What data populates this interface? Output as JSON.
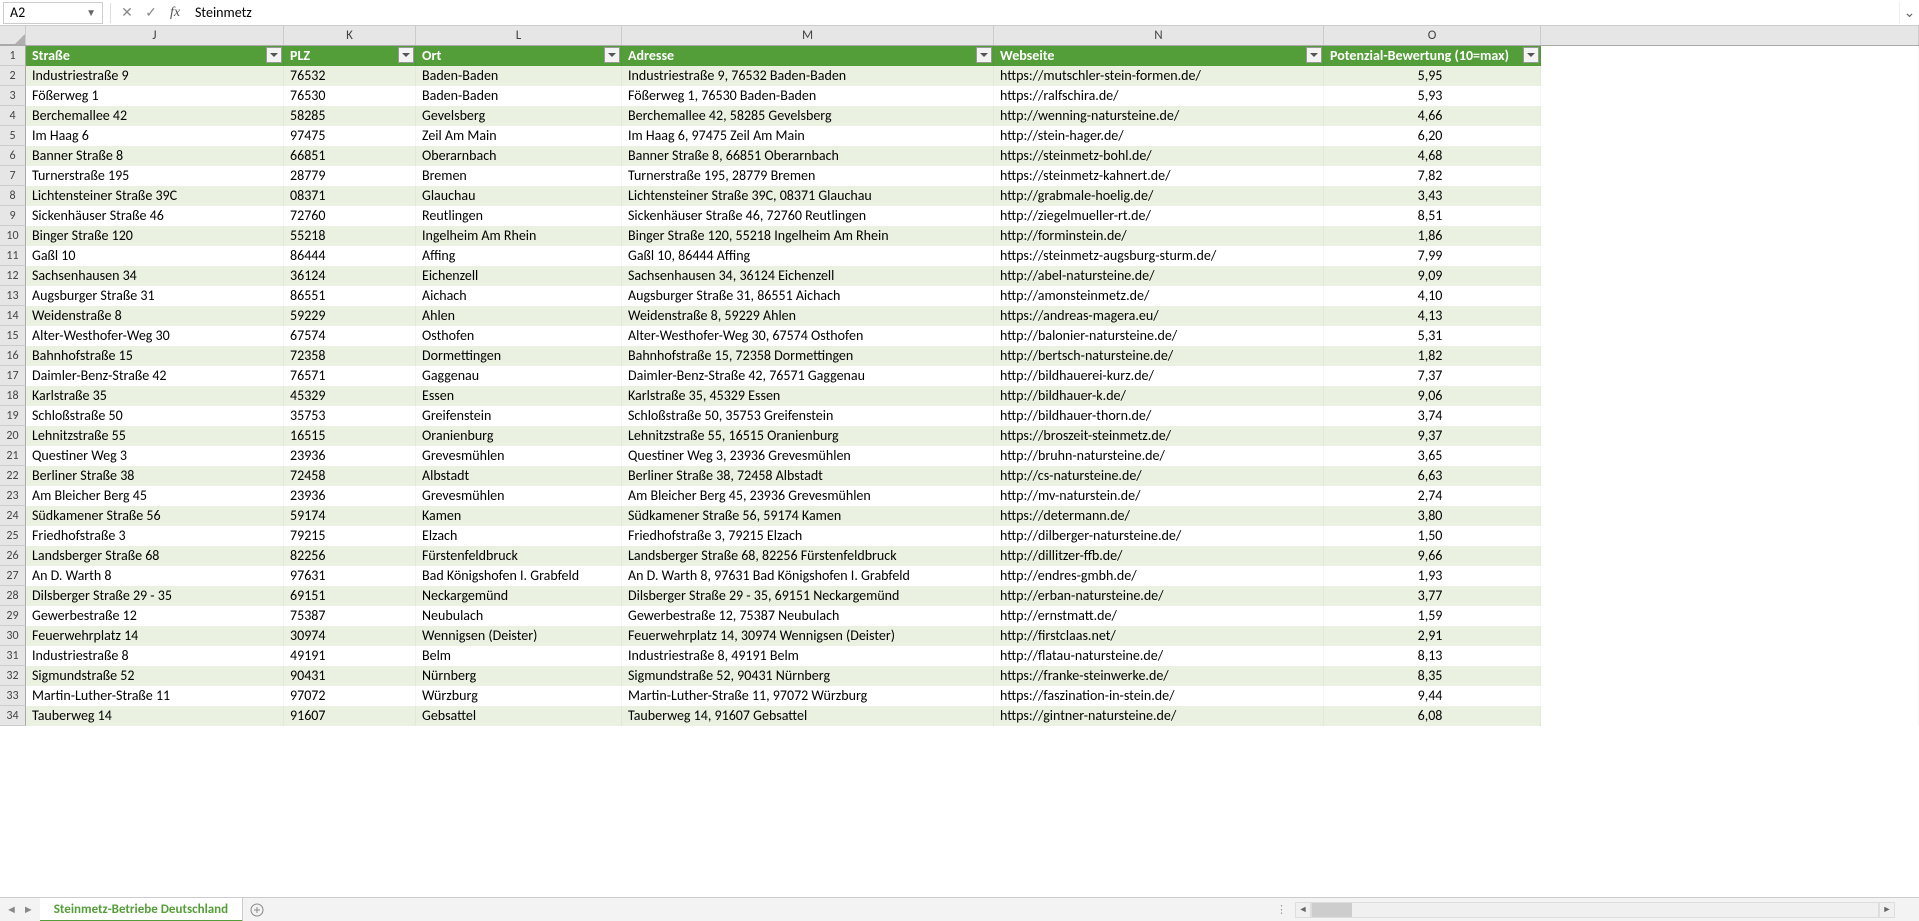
{
  "formula_bar": {
    "name_box": "A2",
    "formula": "Steinmetz"
  },
  "columns": [
    {
      "letter": "J",
      "label": "Straße",
      "cls": "col-J"
    },
    {
      "letter": "K",
      "label": "PLZ",
      "cls": "col-K"
    },
    {
      "letter": "L",
      "label": "Ort",
      "cls": "col-L"
    },
    {
      "letter": "M",
      "label": "Adresse",
      "cls": "col-M"
    },
    {
      "letter": "N",
      "label": "Webseite",
      "cls": "col-N"
    },
    {
      "letter": "O",
      "label": "Potenzial-Bewertung (10=max)",
      "cls": "col-O",
      "numeric": true
    }
  ],
  "rows": [
    {
      "n": 2,
      "d": [
        "Industriestraße 9",
        "76532",
        "Baden-Baden",
        "Industriestraße 9, 76532 Baden-Baden",
        "https://mutschler-stein-formen.de/",
        "5,95"
      ]
    },
    {
      "n": 3,
      "d": [
        "Fößerweg 1",
        "76530",
        "Baden-Baden",
        "Fößerweg 1, 76530 Baden-Baden",
        "https://ralfschira.de/",
        "5,93"
      ]
    },
    {
      "n": 4,
      "d": [
        "Berchemallee 42",
        "58285",
        "Gevelsberg",
        "Berchemallee 42, 58285 Gevelsberg",
        "http://wenning-natursteine.de/",
        "4,66"
      ]
    },
    {
      "n": 5,
      "d": [
        "Im Haag 6",
        "97475",
        "Zeil Am Main",
        "Im Haag 6, 97475 Zeil Am Main",
        "http://stein-hager.de/",
        "6,20"
      ]
    },
    {
      "n": 6,
      "d": [
        "Banner Straße 8",
        "66851",
        "Oberarnbach",
        "Banner Straße 8, 66851 Oberarnbach",
        "https://steinmetz-bohl.de/",
        "4,68"
      ]
    },
    {
      "n": 7,
      "d": [
        "Turnerstraße 195",
        "28779",
        "Bremen",
        "Turnerstraße 195, 28779 Bremen",
        "https://steinmetz-kahnert.de/",
        "7,82"
      ]
    },
    {
      "n": 8,
      "d": [
        "Lichtensteiner Straße 39C",
        "08371",
        "Glauchau",
        "Lichtensteiner Straße 39C, 08371 Glauchau",
        "http://grabmale-hoelig.de/",
        "3,43"
      ]
    },
    {
      "n": 9,
      "d": [
        "Sickenhäuser Straße 46",
        "72760",
        "Reutlingen",
        "Sickenhäuser Straße 46, 72760 Reutlingen",
        "http://ziegelmueller-rt.de/",
        "8,51"
      ]
    },
    {
      "n": 10,
      "d": [
        "Binger Straße 120",
        "55218",
        "Ingelheim Am Rhein",
        "Binger Straße 120, 55218 Ingelheim Am Rhein",
        "http://forminstein.de/",
        "1,86"
      ]
    },
    {
      "n": 11,
      "d": [
        "Gaßl 10",
        "86444",
        "Affing",
        "Gaßl 10, 86444 Affing",
        "https://steinmetz-augsburg-sturm.de/",
        "7,99"
      ]
    },
    {
      "n": 12,
      "d": [
        "Sachsenhausen 34",
        "36124",
        "Eichenzell",
        "Sachsenhausen 34, 36124 Eichenzell",
        "http://abel-natursteine.de/",
        "9,09"
      ]
    },
    {
      "n": 13,
      "d": [
        "Augsburger Straße 31",
        "86551",
        "Aichach",
        "Augsburger Straße 31, 86551 Aichach",
        "http://amonsteinmetz.de/",
        "4,10"
      ]
    },
    {
      "n": 14,
      "d": [
        "Weidenstraße 8",
        "59229",
        "Ahlen",
        "Weidenstraße 8, 59229 Ahlen",
        "https://andreas-magera.eu/",
        "4,13"
      ]
    },
    {
      "n": 15,
      "d": [
        "Alter-Westhofer-Weg 30",
        "67574",
        "Osthofen",
        "Alter-Westhofer-Weg 30, 67574 Osthofen",
        "http://balonier-natursteine.de/",
        "5,31"
      ]
    },
    {
      "n": 16,
      "d": [
        "Bahnhofstraße 15",
        "72358",
        "Dormettingen",
        "Bahnhofstraße 15, 72358 Dormettingen",
        "http://bertsch-natursteine.de/",
        "1,82"
      ]
    },
    {
      "n": 17,
      "d": [
        "Daimler-Benz-Straße 42",
        "76571",
        "Gaggenau",
        "Daimler-Benz-Straße 42, 76571 Gaggenau",
        "http://bildhauerei-kurz.de/",
        "7,37"
      ]
    },
    {
      "n": 18,
      "d": [
        "Karlstraße 35",
        "45329",
        "Essen",
        "Karlstraße 35, 45329 Essen",
        "http://bildhauer-k.de/",
        "9,06"
      ]
    },
    {
      "n": 19,
      "d": [
        "Schloßstraße 50",
        "35753",
        "Greifenstein",
        "Schloßstraße 50, 35753 Greifenstein",
        "http://bildhauer-thorn.de/",
        "3,74"
      ]
    },
    {
      "n": 20,
      "d": [
        "Lehnitzstraße 55",
        "16515",
        "Oranienburg",
        "Lehnitzstraße 55, 16515 Oranienburg",
        "https://broszeit-steinmetz.de/",
        "9,37"
      ]
    },
    {
      "n": 21,
      "d": [
        "Questiner Weg 3",
        "23936",
        "Grevesmühlen",
        "Questiner Weg 3, 23936 Grevesmühlen",
        "http://bruhn-natursteine.de/",
        "3,65"
      ]
    },
    {
      "n": 22,
      "d": [
        "Berliner Straße 38",
        "72458",
        "Albstadt",
        "Berliner Straße 38, 72458 Albstadt",
        "http://cs-natursteine.de/",
        "6,63"
      ]
    },
    {
      "n": 23,
      "d": [
        "Am Bleicher Berg 45",
        "23936",
        "Grevesmühlen",
        "Am Bleicher Berg 45, 23936 Grevesmühlen",
        "http://mv-naturstein.de/",
        "2,74"
      ]
    },
    {
      "n": 24,
      "d": [
        "Südkamener Straße 56",
        "59174",
        "Kamen",
        "Südkamener Straße 56, 59174 Kamen",
        "https://determann.de/",
        "3,80"
      ]
    },
    {
      "n": 25,
      "d": [
        "Friedhofstraße 3",
        "79215",
        "Elzach",
        "Friedhofstraße 3, 79215 Elzach",
        "http://dilberger-natursteine.de/",
        "1,50"
      ]
    },
    {
      "n": 26,
      "d": [
        "Landsberger Straße 68",
        "82256",
        "Fürstenfeldbruck",
        "Landsberger Straße 68, 82256 Fürstenfeldbruck",
        "http://dillitzer-ffb.de/",
        "9,66"
      ]
    },
    {
      "n": 27,
      "d": [
        "An D. Warth 8",
        "97631",
        "Bad Königshofen I. Grabfeld",
        "An D. Warth 8, 97631 Bad Königshofen I. Grabfeld",
        "http://endres-gmbh.de/",
        "1,93"
      ]
    },
    {
      "n": 28,
      "d": [
        "Dilsberger Straße 29 - 35",
        "69151",
        "Neckargemünd",
        "Dilsberger Straße 29 - 35, 69151 Neckargemünd",
        "http://erban-natursteine.de/",
        "3,77"
      ]
    },
    {
      "n": 29,
      "d": [
        "Gewerbestraße 12",
        "75387",
        "Neubulach",
        "Gewerbestraße 12, 75387 Neubulach",
        "http://ernstmatt.de/",
        "1,59"
      ]
    },
    {
      "n": 30,
      "d": [
        "Feuerwehrplatz 14",
        "30974",
        "Wennigsen (Deister)",
        "Feuerwehrplatz 14, 30974 Wennigsen (Deister)",
        "http://firstclaas.net/",
        "2,91"
      ]
    },
    {
      "n": 31,
      "d": [
        "Industriestraße 8",
        "49191",
        "Belm",
        "Industriestraße 8, 49191 Belm",
        "http://flatau-natursteine.de/",
        "8,13"
      ]
    },
    {
      "n": 32,
      "d": [
        "Sigmundstraße 52",
        "90431",
        "Nürnberg",
        "Sigmundstraße 52, 90431 Nürnberg",
        "https://franke-steinwerke.de/",
        "8,35"
      ]
    },
    {
      "n": 33,
      "d": [
        "Martin-Luther-Straße 11",
        "97072",
        "Würzburg",
        "Martin-Luther-Straße 11, 97072 Würzburg",
        "https://faszination-in-stein.de/",
        "9,44"
      ]
    },
    {
      "n": 34,
      "d": [
        "Tauberweg 14",
        "91607",
        "Gebsattel",
        "Tauberweg 14, 91607 Gebsattel",
        "https://gintner-natursteine.de/",
        "6,08"
      ]
    }
  ],
  "sheet_tab": "Steinmetz-Betriebe Deutschland"
}
